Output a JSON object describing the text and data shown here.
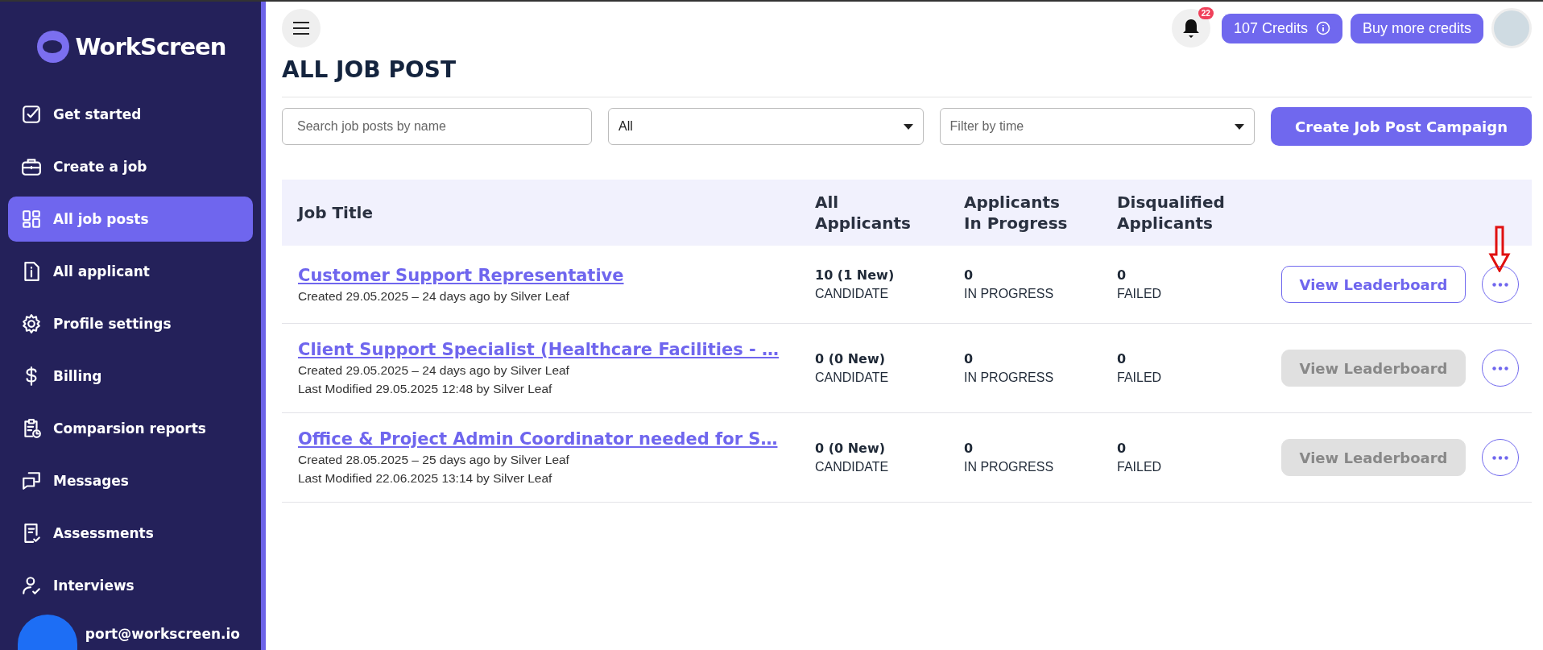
{
  "sidebar": {
    "logo": "WorkScreen",
    "items": [
      {
        "label": "Get started",
        "selected": false
      },
      {
        "label": "Create a job",
        "selected": false
      },
      {
        "label": "All job posts",
        "selected": true
      },
      {
        "label": "All applicant",
        "selected": false
      },
      {
        "label": "Profile settings",
        "selected": false
      },
      {
        "label": "Billing",
        "selected": false
      },
      {
        "label": "Comparsion reports",
        "selected": false
      },
      {
        "label": "Messages",
        "selected": false
      },
      {
        "label": "Assessments",
        "selected": false
      },
      {
        "label": "Interviews",
        "selected": false
      }
    ],
    "support": "port@workscreen.io"
  },
  "header": {
    "notifications": "22",
    "credits": "107 Credits",
    "buy_button": "Buy more credits"
  },
  "page_title": "ALL JOB POST",
  "filters": {
    "search": {
      "placeholder": "Search job posts by name"
    },
    "status": {
      "value": "All"
    },
    "time": {
      "placeholder": "Filter by time"
    },
    "create_button": "Create Job Post Campaign"
  },
  "table": {
    "columns": [
      "Job Title",
      "All Applicants",
      "Applicants In Progress",
      "Disqualified Applicants"
    ],
    "rows": [
      {
        "title": "Customer Support Representative",
        "meta": [
          "Created 29.05.2025 – 24 days ago by Silver Leaf"
        ],
        "stats": [
          {
            "value": "10 (1 New)",
            "label": "CANDIDATE"
          },
          {
            "value": "0",
            "label": "IN PROGRESS"
          },
          {
            "value": "0",
            "label": "FAILED"
          }
        ],
        "button": {
          "label": "View Leaderboard",
          "disabled": false
        },
        "pointed": true
      },
      {
        "title": "Client Support Specialist (Healthcare Facilities - …",
        "meta": [
          "Created 29.05.2025 – 24 days ago by Silver Leaf",
          "Last Modified 29.05.2025 12:48 by Silver Leaf"
        ],
        "stats": [
          {
            "value": "0 (0 New)",
            "label": "CANDIDATE"
          },
          {
            "value": "0",
            "label": "IN PROGRESS"
          },
          {
            "value": "0",
            "label": "FAILED"
          }
        ],
        "button": {
          "label": "View Leaderboard",
          "disabled": true
        },
        "pointed": false
      },
      {
        "title": "Office & Project Admin Coordinator needed for S…",
        "meta": [
          "Created 28.05.2025 – 25 days ago by Silver Leaf",
          "Last Modified 22.06.2025 13:14 by Silver Leaf"
        ],
        "stats": [
          {
            "value": "0 (0 New)",
            "label": "CANDIDATE"
          },
          {
            "value": "0",
            "label": "IN PROGRESS"
          },
          {
            "value": "0",
            "label": "FAILED"
          }
        ],
        "button": {
          "label": "View Leaderboard",
          "disabled": true
        },
        "pointed": false
      }
    ]
  }
}
